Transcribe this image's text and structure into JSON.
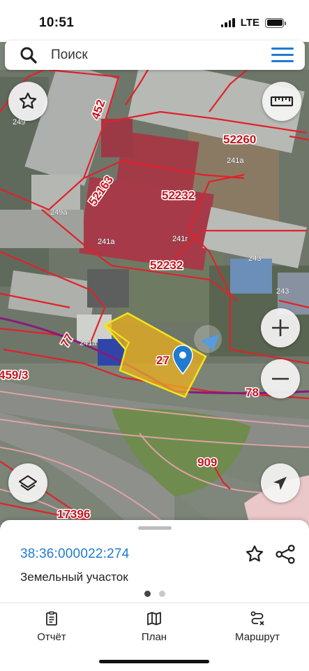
{
  "status_bar": {
    "time": "10:51",
    "network": "LTE"
  },
  "search": {
    "placeholder": "Поиск"
  },
  "map": {
    "parcel_numbers": [
      "452",
      "52260",
      "52163",
      "52232",
      "52232",
      "77",
      "27",
      "459/3",
      "78",
      "909",
      "17396"
    ],
    "building_labels": [
      "249",
      "241a",
      "249a",
      "241a",
      "241r",
      "241a",
      "243",
      "243"
    ],
    "colors": {
      "parcel_border": "#e1212a",
      "selected_fill": "#f2b21a",
      "selected_border": "#f3e51c",
      "marker": "#1f7bd0",
      "road_line": "#8a1a7a"
    }
  },
  "controls": {
    "favorite": "star-icon",
    "ruler": "ruler-icon",
    "zoom_in": "plus-icon",
    "zoom_out": "minus-icon",
    "layers": "layers-icon",
    "locate": "navigation-arrow-icon"
  },
  "sheet": {
    "parcel_id": "38:36:000022:274",
    "parcel_type": "Земельный участок",
    "pages": 2,
    "active_page": 1
  },
  "nav": {
    "report": "Отчёт",
    "plan": "План",
    "route": "Маршрут"
  }
}
